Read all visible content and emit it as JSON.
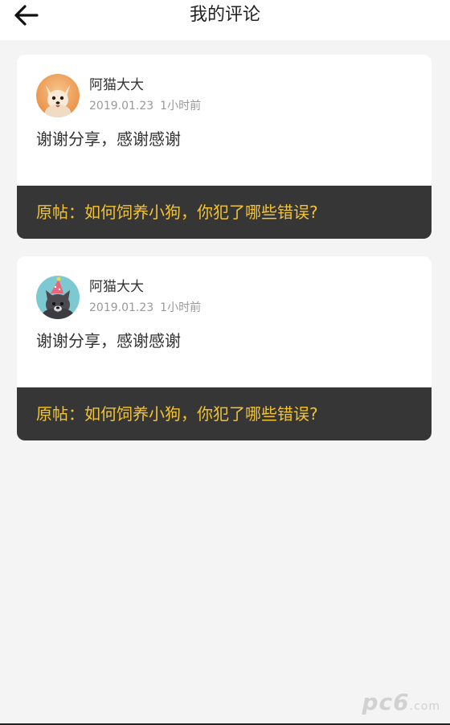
{
  "header": {
    "title": "我的评论",
    "back_icon": "arrow-left-icon"
  },
  "comments": [
    {
      "username": "阿猫大大",
      "date": "2019.01.23",
      "time_ago": "1小时前",
      "content": "谢谢分享，感谢感谢",
      "origin_post": "原帖：如何饲养小狗，你犯了哪些错误?",
      "avatar_icon": "dog-avatar-icon"
    },
    {
      "username": "阿猫大大",
      "date": "2019.01.23",
      "time_ago": "1小时前",
      "content": "谢谢分享，感谢感谢",
      "origin_post": "原帖：如何饲养小狗，你犯了哪些错误?",
      "avatar_icon": "dog-party-hat-avatar-icon"
    }
  ],
  "watermark": {
    "text": "pc6",
    "suffix": ".com"
  },
  "colors": {
    "accent": "#f2c335",
    "origin_bar_bg": "#363636",
    "page_bg": "#f4f4f4"
  }
}
